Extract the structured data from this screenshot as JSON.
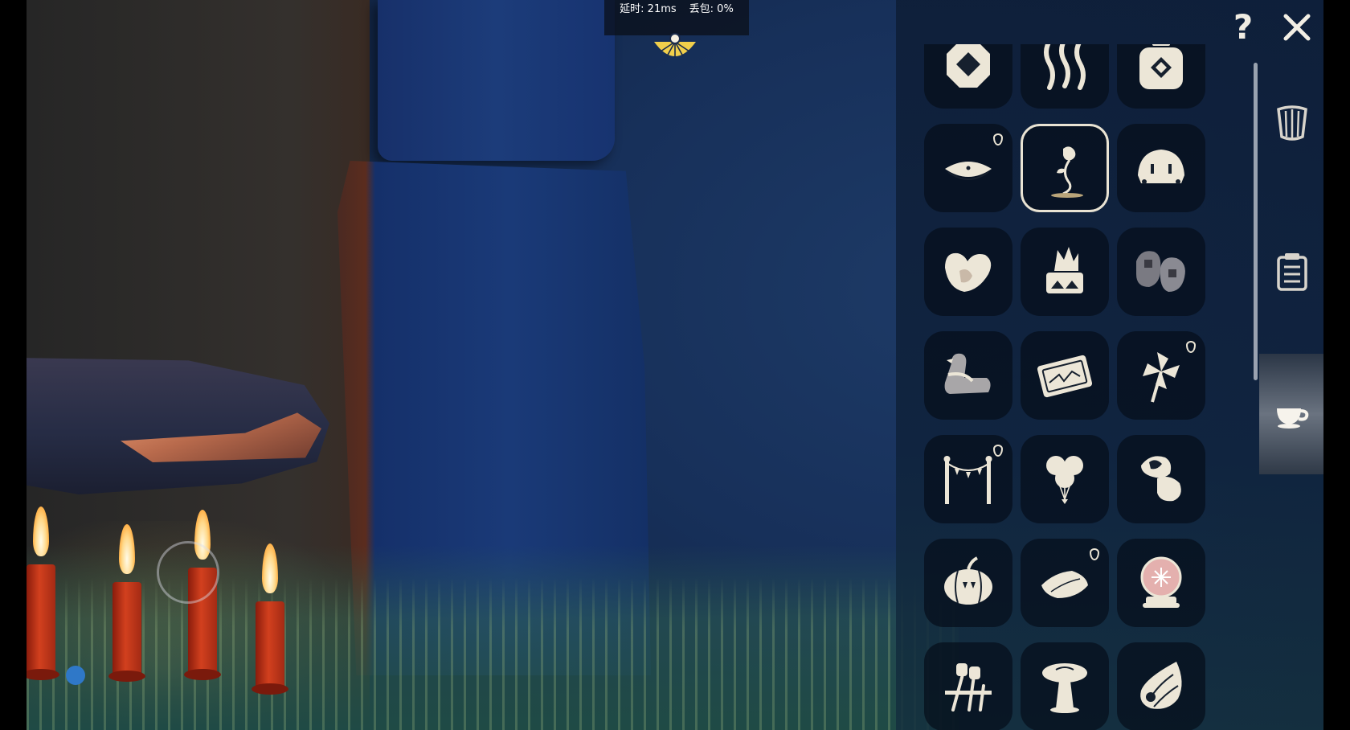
{
  "hud": {
    "latency": "延时: 21ms",
    "packet_loss": "丢包: 0%"
  },
  "panel": {
    "help_label": "?",
    "items": [
      {
        "icon": "octagon-token-icon",
        "selected": false,
        "drop": false
      },
      {
        "icon": "steam-waves-icon",
        "selected": false,
        "drop": false
      },
      {
        "icon": "potion-bottle-icon",
        "selected": false,
        "drop": false
      },
      {
        "icon": "cushion-icon",
        "selected": false,
        "drop": true
      },
      {
        "icon": "rose-icon",
        "selected": true,
        "drop": false
      },
      {
        "icon": "turtle-shell-icon",
        "selected": false,
        "drop": false
      },
      {
        "icon": "heart-stones-icon",
        "selected": false,
        "drop": false
      },
      {
        "icon": "crystal-cake-icon",
        "selected": false,
        "drop": false
      },
      {
        "icon": "rock-pair-icon",
        "selected": false,
        "drop": false
      },
      {
        "icon": "bird-statue-icon",
        "selected": false,
        "drop": false
      },
      {
        "icon": "constellation-mat-icon",
        "selected": false,
        "drop": false
      },
      {
        "icon": "pinwheel-icon",
        "selected": false,
        "drop": true
      },
      {
        "icon": "bunting-posts-icon",
        "selected": false,
        "drop": true
      },
      {
        "icon": "balloons-icon",
        "selected": false,
        "drop": false
      },
      {
        "icon": "rock-pile-icon",
        "selected": false,
        "drop": false
      },
      {
        "icon": "pumpkin-icon",
        "selected": false,
        "drop": false
      },
      {
        "icon": "pillow-icon",
        "selected": false,
        "drop": true
      },
      {
        "icon": "snow-globe-icon",
        "selected": false,
        "drop": false
      },
      {
        "icon": "marshmallow-sticks-icon",
        "selected": false,
        "drop": false
      },
      {
        "icon": "mushroom-table-icon",
        "selected": false,
        "drop": false
      },
      {
        "icon": "conch-shell-icon",
        "selected": false,
        "drop": false
      }
    ],
    "side_tabs": [
      {
        "icon": "harp-icon",
        "active": false
      },
      {
        "icon": "clipboard-icon",
        "active": false
      },
      {
        "icon": "teacup-icon",
        "active": true
      }
    ]
  }
}
